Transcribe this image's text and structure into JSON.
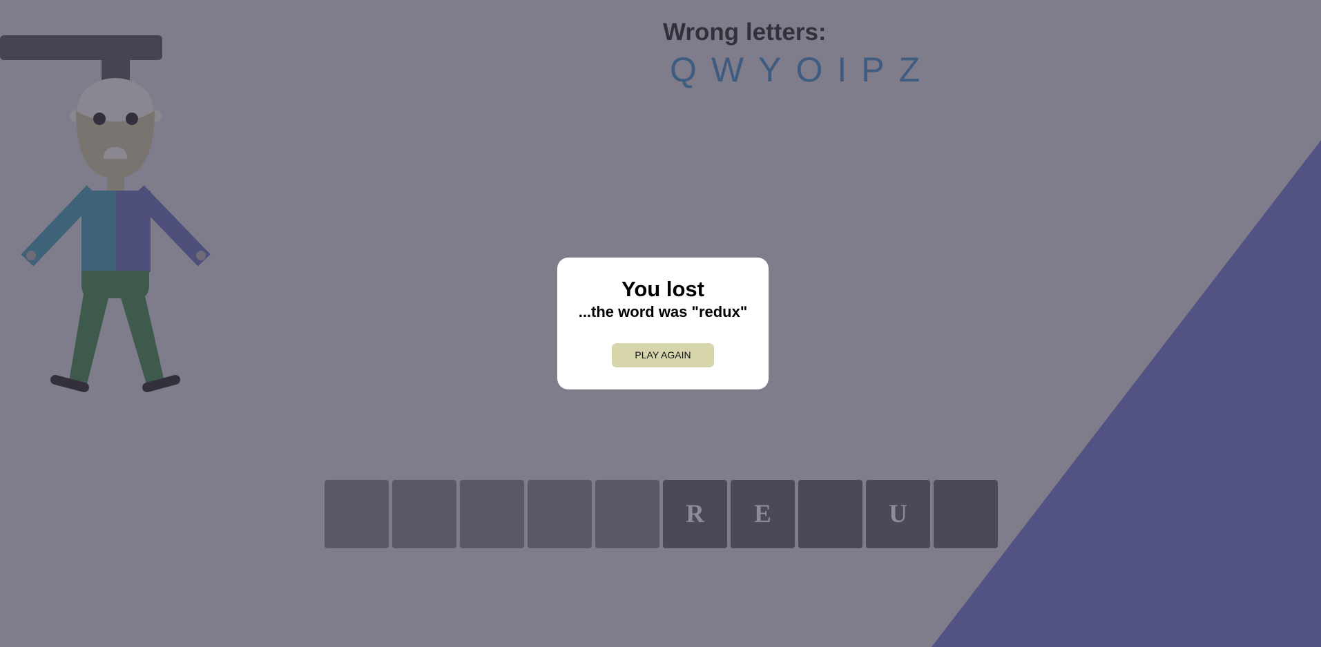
{
  "wrong_letters": {
    "title": "Wrong letters:",
    "letters": [
      "Q",
      "W",
      "Y",
      "O",
      "I",
      "P",
      "Z"
    ]
  },
  "word": {
    "slots": [
      "",
      "",
      "",
      "",
      "",
      "R",
      "E",
      "",
      "U",
      ""
    ]
  },
  "modal": {
    "title": "You lost",
    "message": "...the word was \"redux\"",
    "button_label": "PLAY AGAIN"
  },
  "colors": {
    "background": "#7f7c8b",
    "triangle": "#525283",
    "wrong_letters": "#3e5b80",
    "button": "#d6d5ac"
  },
  "icons": {
    "figure": "hangman-figure",
    "gallows": "gallows-beam-icon"
  }
}
